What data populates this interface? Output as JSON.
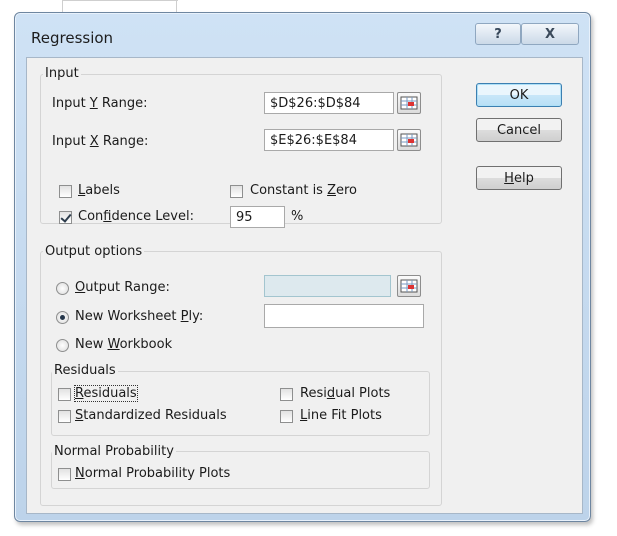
{
  "window": {
    "title": "Regression",
    "help_icon_label": "?",
    "close_icon_label": "X"
  },
  "input": {
    "group_label": "Input",
    "y_range_label": "Input Y Range:",
    "y_range_value": "$D$26:$D$84",
    "x_range_label": "Input X Range:",
    "x_range_value": "$E$26:$E$84",
    "labels_label": "Labels",
    "labels_checked": false,
    "constant_zero_label": "Constant is Zero",
    "constant_zero_checked": false,
    "confidence_label": "Confidence Level:",
    "confidence_checked": true,
    "confidence_value": "95",
    "percent_label": "%"
  },
  "output": {
    "group_label": "Output options",
    "output_range_label": "Output Range:",
    "output_range_value": "",
    "new_ply_label": "New Worksheet Ply:",
    "new_ply_value": "",
    "new_workbook_label": "New Workbook",
    "selected": "new_worksheet_ply"
  },
  "residuals": {
    "group_label": "Residuals",
    "residuals_label": "Residuals",
    "residual_plots_label": "Residual Plots",
    "standardized_label": "Standardized Residuals",
    "line_fit_label": "Line Fit Plots"
  },
  "normal_probability": {
    "group_label": "Normal Probability",
    "plots_label": "Normal Probability Plots"
  },
  "buttons": {
    "ok": "OK",
    "cancel": "Cancel",
    "help": "Help"
  },
  "colors": {
    "frame": "#bdd3ea",
    "client": "#f0f0f0",
    "default_button": "#c8e7f9"
  }
}
